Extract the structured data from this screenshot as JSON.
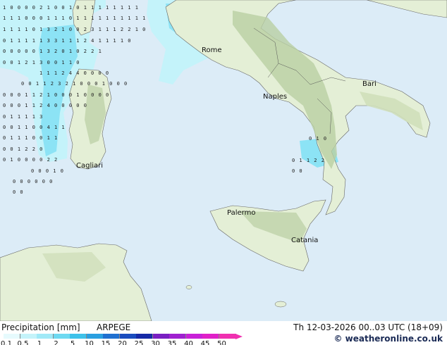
{
  "cities": [
    {
      "name": "Rome"
    },
    {
      "name": "Bari"
    },
    {
      "name": "Naples"
    },
    {
      "name": "Cagliari"
    },
    {
      "name": "Palermo"
    },
    {
      "name": "Catania"
    }
  ],
  "grid_values": [
    "1 0 0   0 0 2 1       0 0 1   0   1 1 1 1 1 1 1 1",
    "1 1 1 0 0 0 1 1 1 0     1 1 1 1 1 1 1 1 1 1",
    "1 1 1 1 0 1 3 2 1 0     0 2 3 1 1 1 2 2 1 0",
    "0 1 1 1 1 1 3 3 1 1     1 2 4 1 1 1 1 0",
    "0 0 0 0 0 1 3 2 0 1     0 2 2 1",
    "0 0   1 2 1 3 0     0 1 1 0",
    "1 1 1 2 4 4     0 0 0   0",
    "0 0 1 1 2 3 2 1   0 0  0 1   0 0 0",
    "0 0 0 1 1 2 1   0  0   0 1 0   0 0 0",
    "0 0 0 1 1 2 4 0   0 0   0 0",
    "0 1 1 1 1 3",
    "0 0 1 1 0 0 4 1 1",
    "0 1 1 1 0 0 1 1",
    "0 0 1   2 2 0",
    "0 1 0 0 0 0 2 2",
    "0 0 0 1 0",
    "0 0 0 0 0 0",
    "0 0",
    "0 1 0",
    "0 1 1 2 2",
    "0 0"
  ],
  "legend": {
    "title": "Precipitation [mm]",
    "model": "ARPEGE",
    "datetime": "Th 12-03-2026 00..03 UTC (18+09)",
    "credit": "© weatheronline.co.uk",
    "scale": [
      {
        "label": "0.1",
        "color": "#e6fafd"
      },
      {
        "label": "0.5",
        "color": "#c4f3fa"
      },
      {
        "label": "1",
        "color": "#a0e9f7"
      },
      {
        "label": "2",
        "color": "#6ed9f1"
      },
      {
        "label": "5",
        "color": "#3ec2ea"
      },
      {
        "label": "10",
        "color": "#2a9fe0"
      },
      {
        "label": "15",
        "color": "#2070d0"
      },
      {
        "label": "20",
        "color": "#1a4cbe"
      },
      {
        "label": "25",
        "color": "#1629a6"
      },
      {
        "label": "30",
        "color": "#7a1fc2"
      },
      {
        "label": "35",
        "color": "#a020d0"
      },
      {
        "label": "40",
        "color": "#c820d8"
      },
      {
        "label": "45",
        "color": "#e020c8"
      },
      {
        "label": "50",
        "color": "#f030b0"
      }
    ]
  },
  "colors": {
    "sea": "#dcecf7",
    "land": "#e4efd6",
    "mountain": "#b9cfa2",
    "precip_light": "#c4f3fa",
    "precip_mid": "#8ce3f5"
  }
}
